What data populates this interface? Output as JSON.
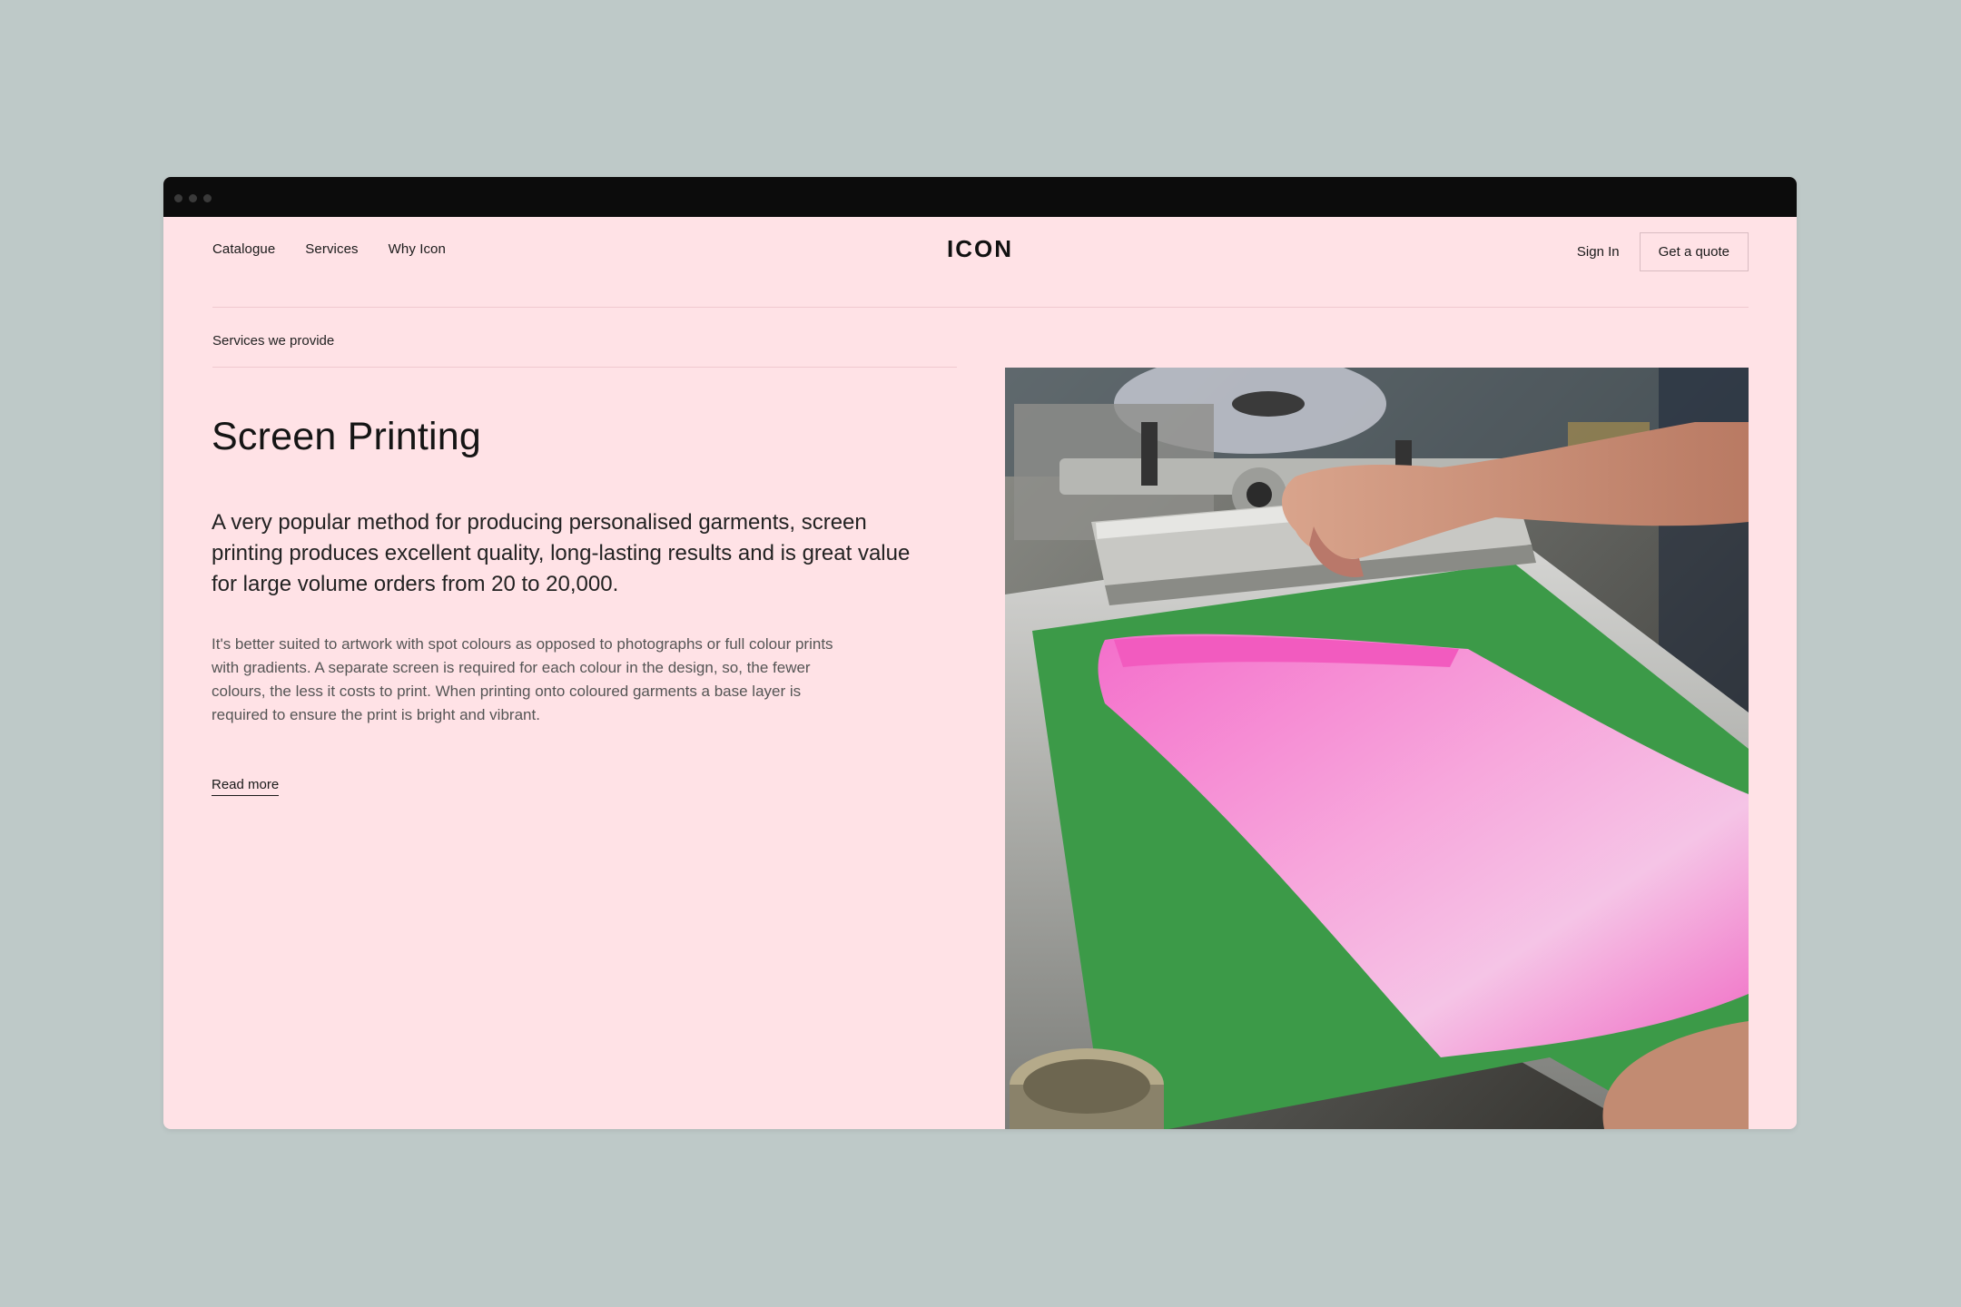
{
  "nav": {
    "links": [
      "Catalogue",
      "Services",
      "Why Icon"
    ],
    "logo": "ICON",
    "sign_in": "Sign In",
    "quote": "Get a quote"
  },
  "section": {
    "label": "Services we provide",
    "title": "Screen Printing",
    "lead": "A very popular method for producing personalised garments, screen printing produces excellent quality, long-lasting results and is great value for large volume orders from 20 to 20,000.",
    "body": "It's better suited to artwork with spot colours as opposed to photographs or full colour prints with gradients. A separate screen is required for each colour in the design, so, the fewer colours, the less it costs to print. When printing onto coloured garments a base layer is required to ensure the print is bright and vibrant.",
    "read_more": "Read more"
  },
  "colors": {
    "background": "#bec9c8",
    "page": "#ffe2e6",
    "titlebar": "#0c0c0c",
    "ink_pink": "#f06ac4",
    "screen_green": "#3c9a48"
  },
  "icons": {
    "window_dots": "window-control-dots"
  }
}
